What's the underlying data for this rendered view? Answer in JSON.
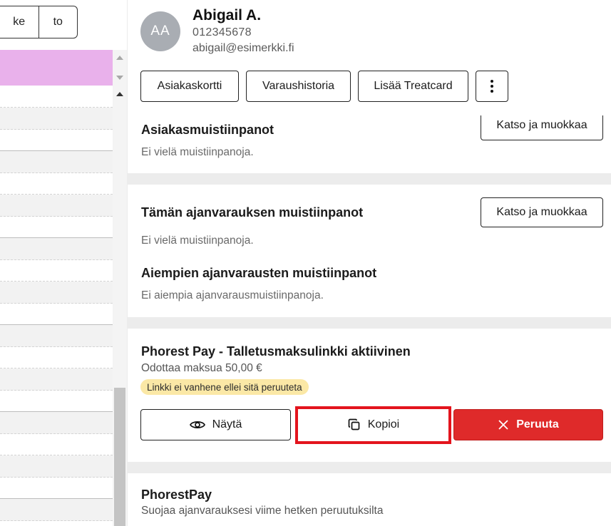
{
  "calendar": {
    "day_toggle": [
      "ke",
      "to"
    ]
  },
  "client": {
    "initials": "AA",
    "name": "Abigail A.",
    "phone": "012345678",
    "email": "abigail@esimerkki.fi",
    "actions": {
      "customer_card": "Asiakaskortti",
      "booking_history": "Varaushistoria",
      "add_treatcard": "Lisää Treatcard"
    }
  },
  "customer_notes": {
    "title": "Asiakasmuistiinpanot",
    "empty_text": "Ei vielä muistiinpanoja.",
    "edit_label": "Katso ja muokkaa"
  },
  "booking_notes": {
    "title": "Tämän ajanvarauksen muistiinpanot",
    "empty_text": "Ei vielä muistiinpanoja.",
    "edit_label": "Katso ja muokkaa",
    "previous_title": "Aiempien ajanvarausten muistiinpanot",
    "previous_empty_text": "Ei aiempia ajanvarausmuistiinpanoja."
  },
  "deposit_link": {
    "title": "Phorest Pay - Talletusmaksulinkki aktiivinen",
    "status": "Odottaa maksua 50,00 €",
    "badge": "Linkki ei vanhene ellei sitä peruuteta",
    "view_label": "Näytä",
    "copy_label": "Kopioi",
    "cancel_label": "Peruuta"
  },
  "phorestpay": {
    "title": "PhorestPay",
    "subtitle": "Suojaa ajanvarauksesi viime hetken peruutuksilta"
  },
  "colors": {
    "appointment": "#e9b1eb",
    "cancel": "#df2a2a",
    "highlight": "#e3141d",
    "badge": "#fbe8a6"
  }
}
